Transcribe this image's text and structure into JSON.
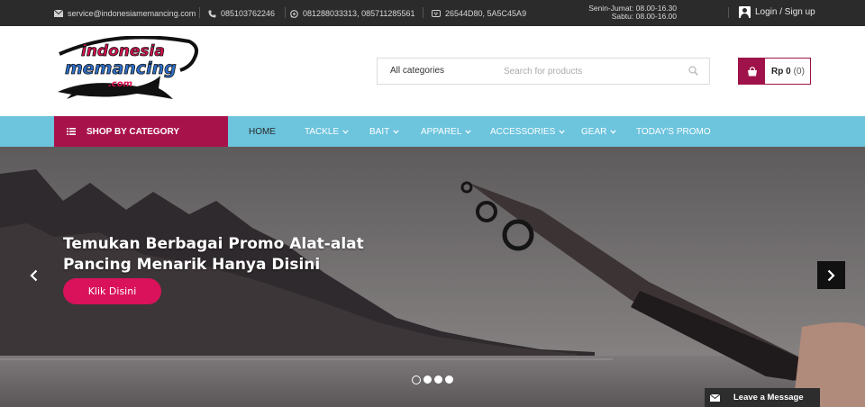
{
  "topbar": {
    "email": "service@indonesiamemancing.com",
    "phone": "085103762246",
    "whatsapp": "081288033313, 085711285561",
    "bbm": "26544D80, 5A5C45A9",
    "hours_weekday": "Senin-Jumat: 08.00-16.30",
    "hours_saturday": "Sabtu: 08.00-16.00",
    "login_label": "Login / Sign up"
  },
  "header": {
    "logo_text_line1": "indonesia",
    "logo_text_line2": "memancing",
    "logo_text_line3": ".com",
    "search_category": "All categories",
    "search_placeholder": "Search for products",
    "cart_total": "Rp 0",
    "cart_count": "(0)"
  },
  "nav": {
    "shop_by_category": "SHOP BY CATEGORY",
    "links": [
      "HOME",
      "TACKLE",
      "BAIT",
      "APPAREL",
      "ACCESSORIES",
      "GEAR",
      "TODAY'S PROMO"
    ]
  },
  "hero": {
    "headline": "Temukan Berbagai Promo Alat-alat Pancing Menarik Hanya Disini",
    "cta_label": "Klik Disini",
    "slide_count": 4,
    "active_slide": 1
  },
  "chat": {
    "label": "Leave a Message"
  },
  "colors": {
    "brand": "#a8124b",
    "nav": "#6cc4dd",
    "cta": "#d9125b",
    "topbar": "#2b2b2b"
  }
}
